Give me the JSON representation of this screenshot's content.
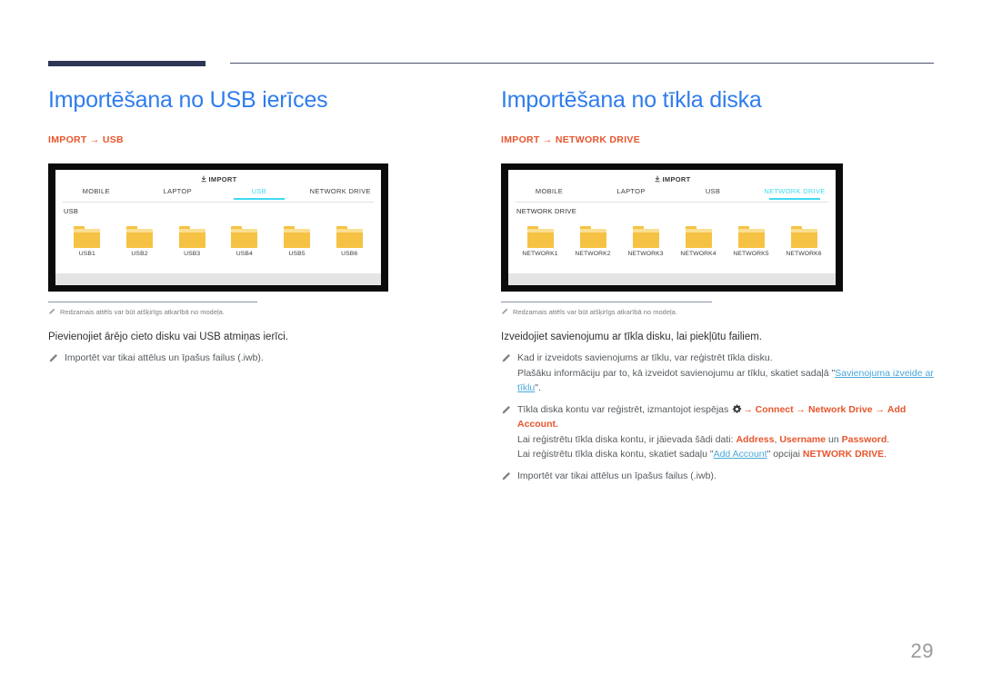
{
  "page": {
    "number": "29"
  },
  "left": {
    "title": "Importēšana no USB ierīces",
    "subtitle": "IMPORT → USB",
    "device": {
      "import_label": "IMPORT",
      "tabs": [
        {
          "label": "MOBILE",
          "active": false
        },
        {
          "label": "LAPTOP",
          "active": false
        },
        {
          "label": "USB",
          "active": true
        },
        {
          "label": "NETWORK DRIVE",
          "active": false
        }
      ],
      "section_label": "USB",
      "folders": [
        "USB1",
        "USB2",
        "USB3",
        "USB4",
        "USB5",
        "USB6"
      ]
    },
    "image_note": "Redzamais attēls var būt atšķirīgs atkarībā no modeļa.",
    "lede": "Pievienojiet ārējo cieto disku vai USB atmiņas ierīci.",
    "bullets": [
      {
        "lines": [
          {
            "text": "Importēt var tikai attēlus un īpašus failus (.iwb)."
          }
        ]
      }
    ]
  },
  "right": {
    "title": "Importēšana no tīkla diska",
    "subtitle": "IMPORT → NETWORK DRIVE",
    "device": {
      "import_label": "IMPORT",
      "tabs": [
        {
          "label": "MOBILE",
          "active": false
        },
        {
          "label": "LAPTOP",
          "active": false
        },
        {
          "label": "USB",
          "active": false
        },
        {
          "label": "NETWORK DRIVE",
          "active": true
        }
      ],
      "section_label": "NETWORK DRIVE",
      "folders": [
        "NETWORK1",
        "NETWORK2",
        "NETWORK3",
        "NETWORK4",
        "NETWORK5",
        "NETWORK6"
      ]
    },
    "image_note": "Redzamais attēls var būt atšķirīgs atkarībā no modeļa.",
    "lede": "Izveidojiet savienojumu ar tīkla disku, lai piekļūtu failiem.",
    "bullet1": {
      "line1": "Kad ir izveidots savienojums ar tīklu, var reģistrēt tīkla disku.",
      "line2_a": "Plašāku informāciju par to, kā izveidot savienojumu ar tīklu, skatiet sadaļā \"",
      "line2_link": "Savienojuma izveide ar tīklu",
      "line2_b": "\"."
    },
    "bullet2": {
      "line1_a": "Tīkla diska kontu var reģistrēt, izmantojot iespējas",
      "line1_arrow1": "→",
      "line1_kw1": "Connect",
      "line1_arrow2": "→",
      "line1_kw2": "Network Drive",
      "line1_arrow3": "→",
      "line1_kw3": "Add Account",
      "line1_end": ".",
      "line2_a": "Lai reģistrētu tīkla diska kontu, ir jāievada šādi dati: ",
      "line2_kw1": "Address",
      "line2_sep1": ", ",
      "line2_kw2": "Username",
      "line2_mid": " un ",
      "line2_kw3": "Password",
      "line2_end": ".",
      "line3_a": "Lai reģistrētu tīkla diska kontu, skatiet sadaļu \"",
      "line3_link": "Add Account",
      "line3_b": "\" opcijai ",
      "line3_kw": "NETWORK DRIVE",
      "line3_end": "."
    },
    "bullet3": "Importēt var tikai attēlus un īpašus failus (.iwb)."
  },
  "colors": {
    "title_blue": "#2f7ded",
    "accent_orange": "#e8552d",
    "link_blue": "#4aa8d8",
    "rule_navy": "#2e3656",
    "tab_active_cyan": "#3fd9f2",
    "folder_yellow": "#f6c243"
  }
}
